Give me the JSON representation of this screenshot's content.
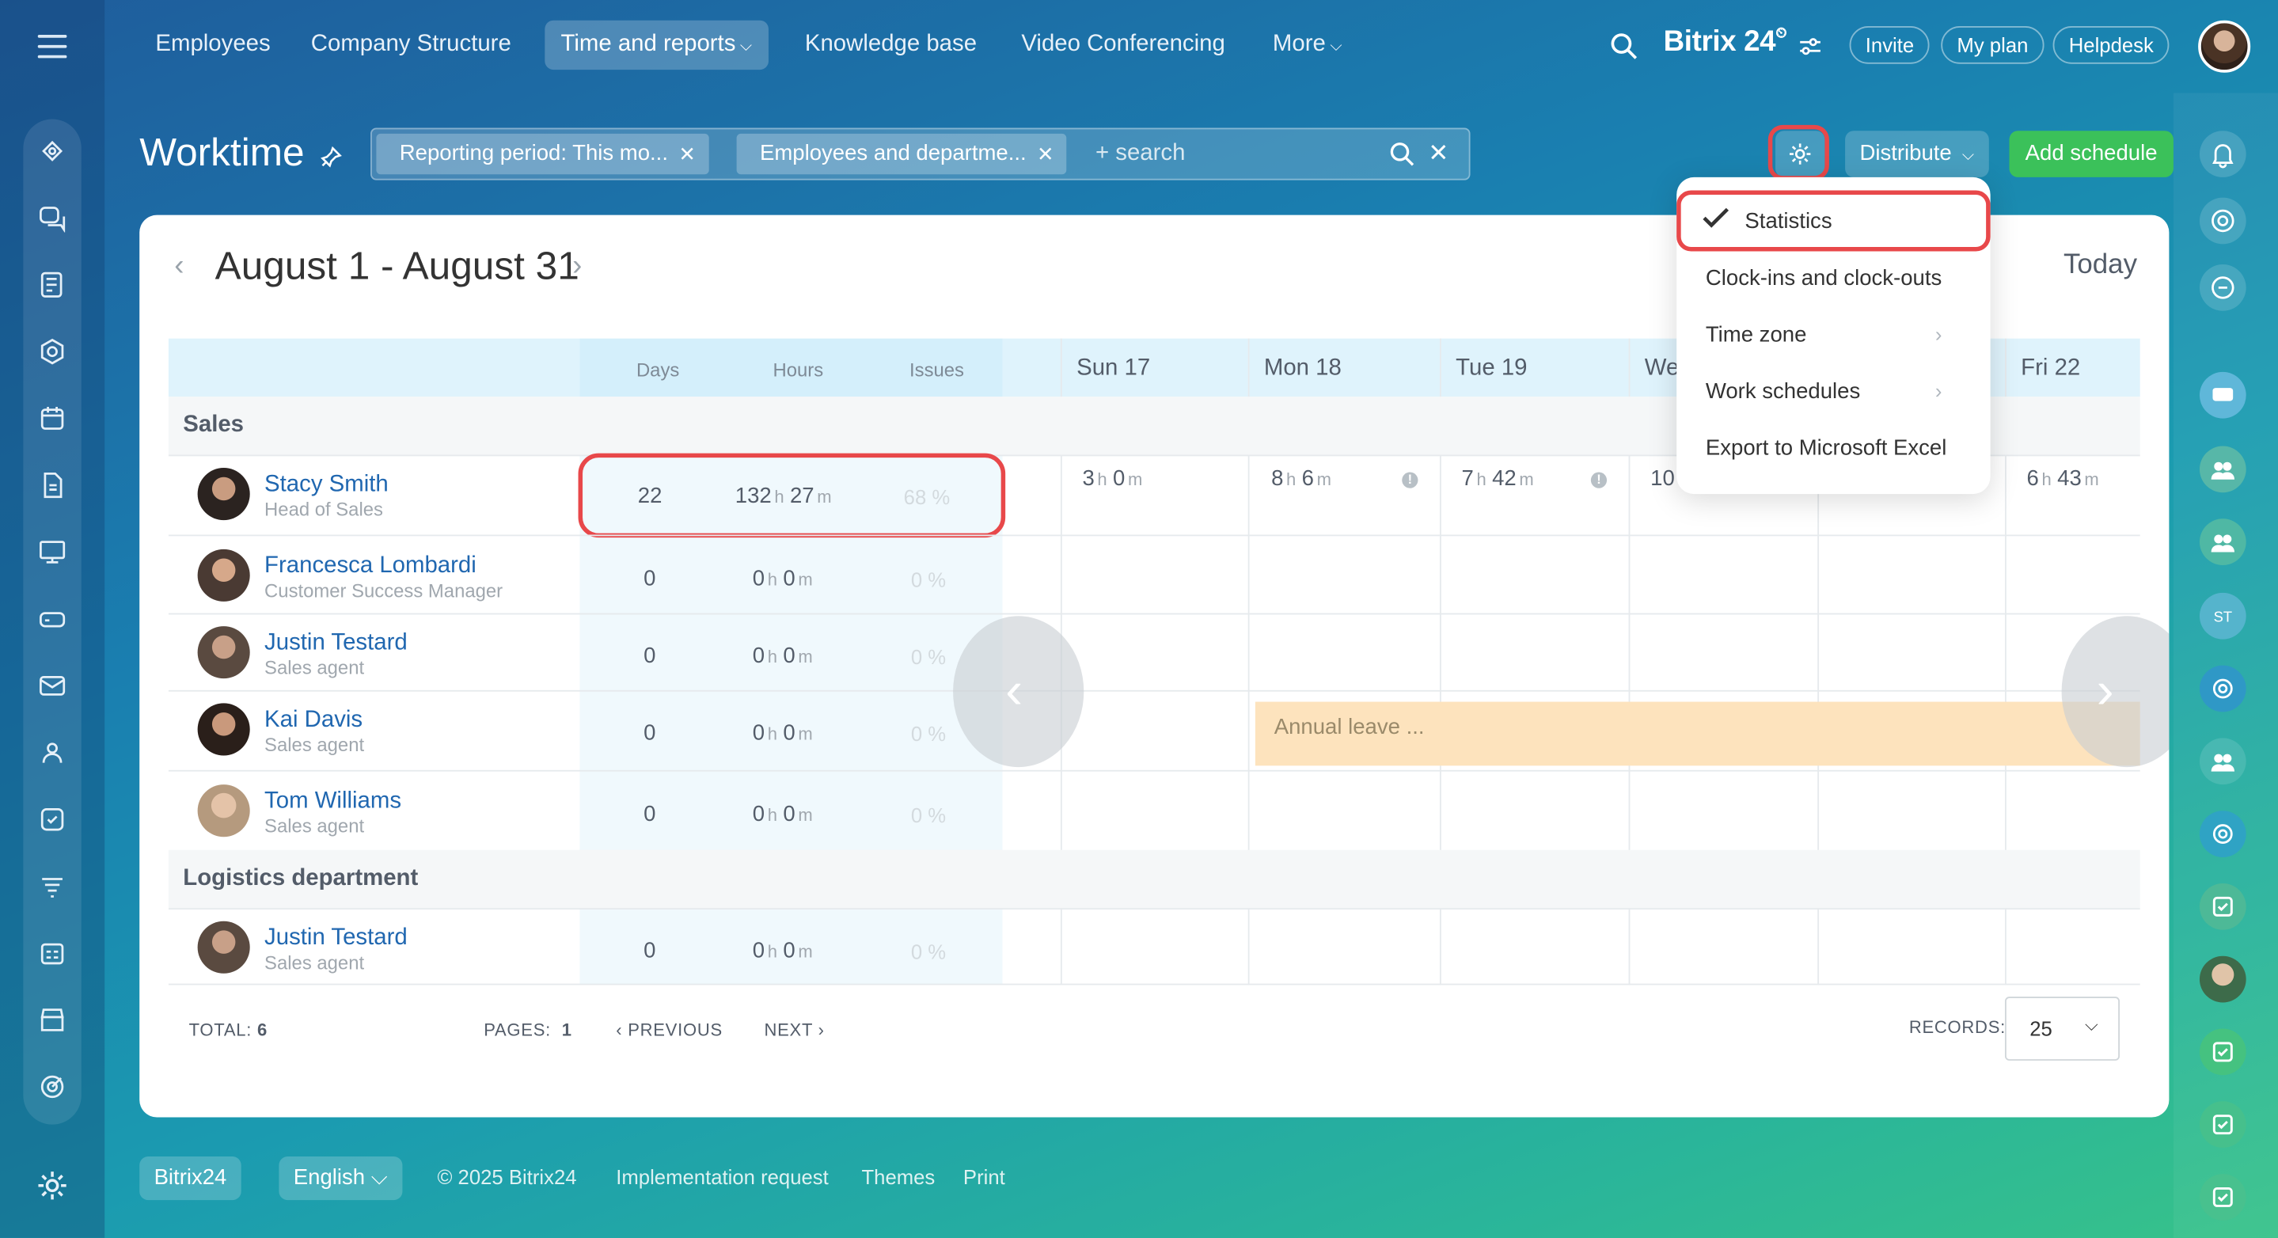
{
  "nav": {
    "items": [
      "Employees",
      "Company Structure",
      "Time and reports",
      "Knowledge base",
      "Video Conferencing",
      "More"
    ],
    "brand": "Bitrix 24",
    "invite": "Invite",
    "my_plan": "My plan",
    "helpdesk": "Helpdesk"
  },
  "header": {
    "title": "Worktime",
    "filters": [
      "Reporting period: This mo...",
      "Employees and departme..."
    ],
    "search_placeholder": "+ search",
    "distribute": "Distribute",
    "add_schedule": "Add schedule"
  },
  "calendar": {
    "period": "August 1 - August 31",
    "today": "Today",
    "stat_headers": [
      "Days",
      "Hours",
      "Issues"
    ],
    "day_headers": [
      "Sun 17",
      "Mon 18",
      "Tue 19",
      "We",
      "Fri 22"
    ]
  },
  "groups": [
    {
      "name": "Sales",
      "employees": [
        {
          "name": "Stacy Smith",
          "position": "Head of Sales",
          "days": "22",
          "hours": "132",
          "minutes": "27",
          "issues": "68 %",
          "cells": [
            {
              "h": "3",
              "m": "0"
            },
            {
              "h": "8",
              "m": "6"
            },
            {
              "h": "7",
              "m": "42"
            },
            {
              "h": "10"
            },
            {
              "h": "6",
              "m": "43"
            }
          ]
        },
        {
          "name": "Francesca Lombardi",
          "position": "Customer Success Manager",
          "days": "0",
          "hours": "0",
          "minutes": "0",
          "issues": "0 %"
        },
        {
          "name": "Justin Testard",
          "position": "Sales agent",
          "days": "0",
          "hours": "0",
          "minutes": "0",
          "issues": "0 %"
        },
        {
          "name": "Kai Davis",
          "position": "Sales agent",
          "days": "0",
          "hours": "0",
          "minutes": "0",
          "issues": "0 %",
          "leave": "Annual leave ..."
        },
        {
          "name": "Tom Williams",
          "position": "Sales agent",
          "days": "0",
          "hours": "0",
          "minutes": "0",
          "issues": "0 %"
        }
      ]
    },
    {
      "name": "Logistics department",
      "employees": [
        {
          "name": "Justin Testard",
          "position": "Sales agent",
          "days": "0",
          "hours": "0",
          "minutes": "0",
          "issues": "0 %"
        }
      ]
    }
  ],
  "units": {
    "h": "h",
    "m": "m"
  },
  "footer": {
    "total_label": "TOTAL:",
    "total": "6",
    "pages_label": "PAGES:",
    "pages": "1",
    "previous": "PREVIOUS",
    "next": "NEXT",
    "records_label": "RECORDS:",
    "records": "25"
  },
  "menu": {
    "items": [
      "Statistics",
      "Clock-ins and clock-outs",
      "Time zone",
      "Work schedules",
      "Export to Microsoft Excel"
    ]
  },
  "bottom": {
    "brand_btn": "Bitrix24",
    "language": "English",
    "copyright": "© 2025 Bitrix24",
    "implementation": "Implementation request",
    "themes": "Themes",
    "print": "Print"
  },
  "colors": {
    "accent_green": "#3bc15a",
    "highlight_red": "#e8484a",
    "link_blue": "#2067b0",
    "leave_orange": "#fde3bd"
  }
}
